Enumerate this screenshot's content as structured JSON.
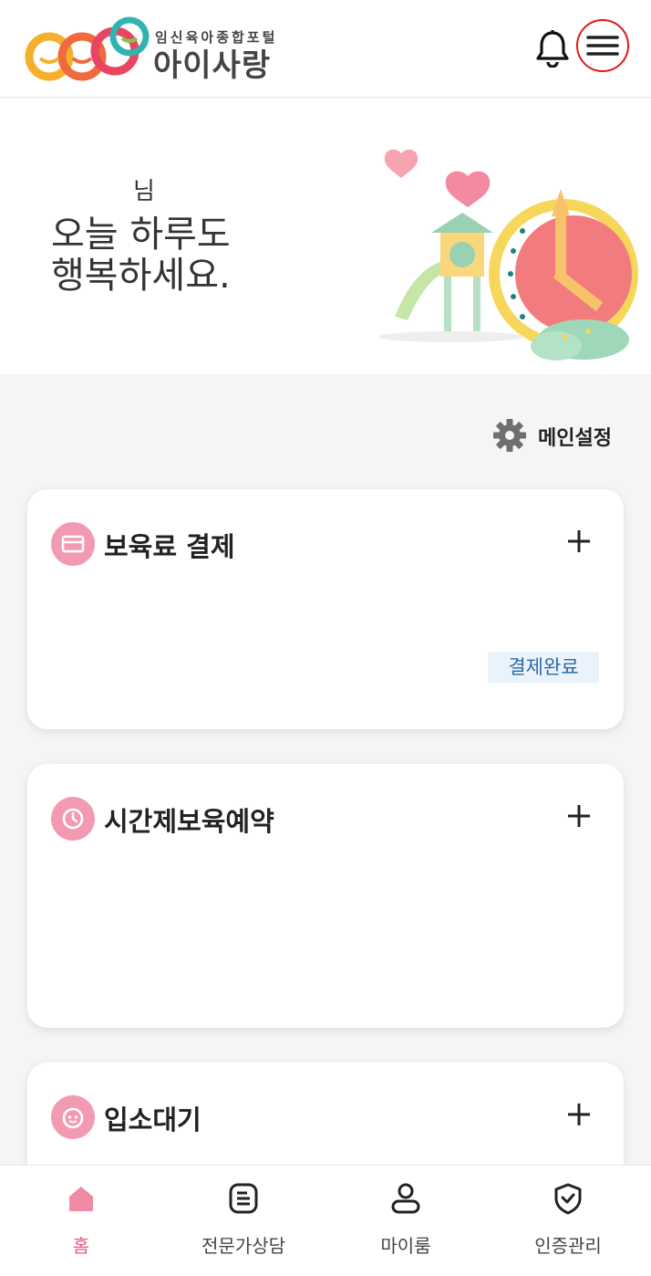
{
  "header": {
    "logo_sub": "임신육아종합포털",
    "logo_main": "아이사랑",
    "notification_icon": "bell-icon",
    "menu_icon": "hamburger-menu-icon"
  },
  "hero": {
    "greeting_name": "님",
    "greeting_line1": "오늘 하루도",
    "greeting_line2": "행복하세요."
  },
  "settings": {
    "label": "메인설정",
    "icon": "gear-icon"
  },
  "cards": [
    {
      "title": "보육료 결제",
      "icon": "card-icon",
      "status": "결제완료"
    },
    {
      "title": "시간제보육예약",
      "icon": "clock-icon"
    },
    {
      "title": "입소대기",
      "icon": "face-icon"
    }
  ],
  "bottom_nav": [
    {
      "label": "홈",
      "icon": "home-icon",
      "active": true
    },
    {
      "label": "전문가상담",
      "icon": "document-icon"
    },
    {
      "label": "마이룸",
      "icon": "person-icon"
    },
    {
      "label": "인증관리",
      "icon": "shield-icon"
    }
  ],
  "colors": {
    "accent": "#e5577a",
    "icon_bg": "#f39ab3",
    "badge_text": "#2a6aa8"
  }
}
